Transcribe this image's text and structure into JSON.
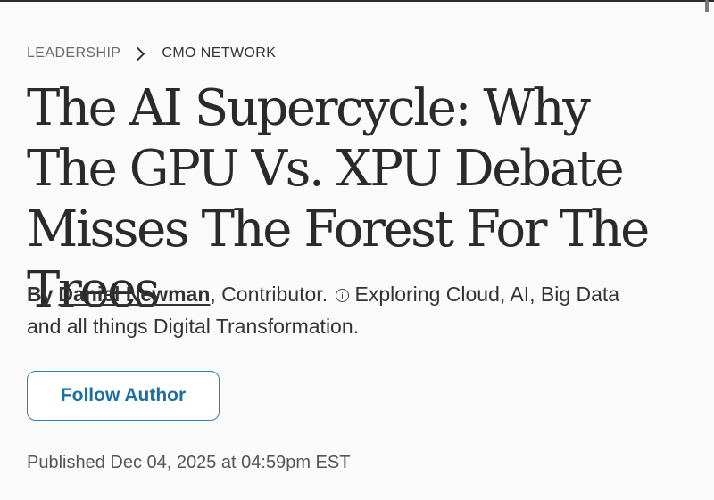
{
  "breadcrumb": {
    "section": "LEADERSHIP",
    "separator_icon": "chevron-right-icon",
    "channel": "CMO NETWORK"
  },
  "article": {
    "headline": "The AI Supercycle: Why The GPU Vs. XPU Debate Misses The Forest For The Trees",
    "byline": {
      "by_label": "By",
      "author_name": "Daniel Newman",
      "role": ", Contributor.",
      "info_icon": "info-circle-icon",
      "description": "Exploring Cloud, AI, Big Data and all things Digital Transformation."
    },
    "follow_label": "Follow Author",
    "published": "Published Dec 04, 2025 at 04:59pm EST"
  },
  "colors": {
    "background": "#fafafa",
    "text": "#333333",
    "headline": "#2a2a2a",
    "muted": "#6a6a6a",
    "accent": "#1a6fa3",
    "button_border": "#2a84b3"
  }
}
